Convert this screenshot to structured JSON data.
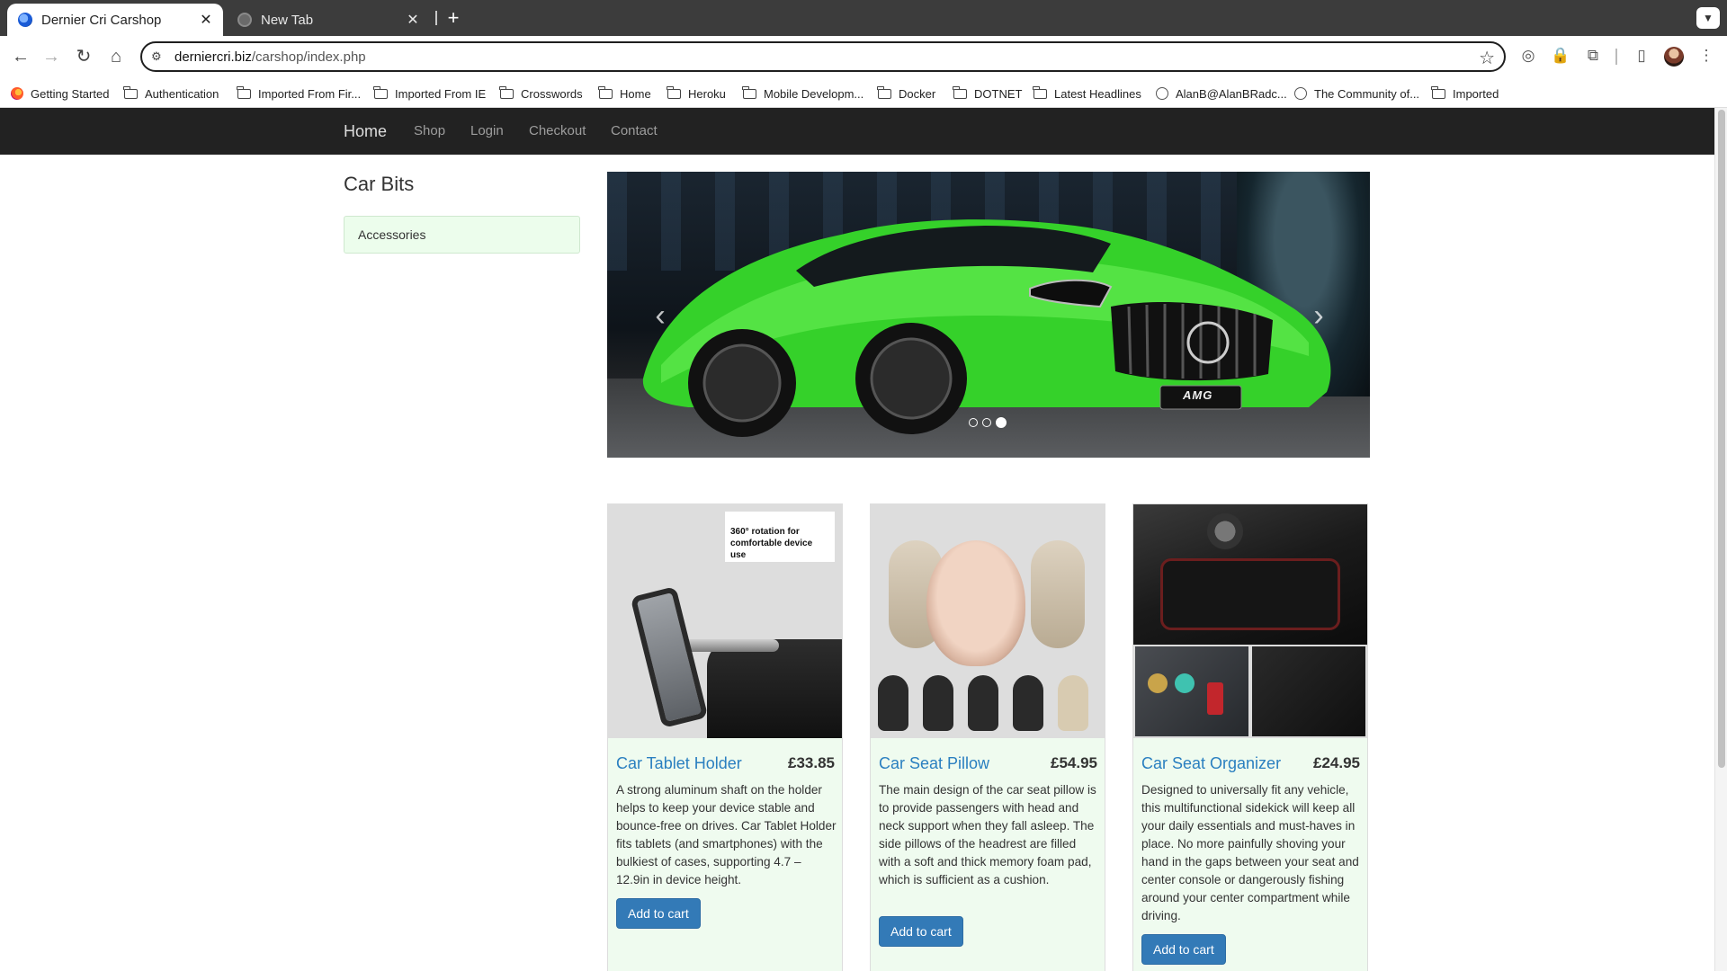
{
  "browser": {
    "tabs": [
      {
        "title": "Dernier Cri Carshop",
        "active": true
      },
      {
        "title": "New Tab",
        "active": false
      }
    ],
    "url_domain": "derniercri.biz",
    "url_path": "/carshop/index.php",
    "bookmarks": [
      {
        "label": "Getting Started",
        "icon": "firefox-icon"
      },
      {
        "label": "Authentication",
        "icon": "folder-icon"
      },
      {
        "label": "Imported From Fir...",
        "icon": "folder-icon"
      },
      {
        "label": "Imported From IE",
        "icon": "folder-icon"
      },
      {
        "label": "Crosswords",
        "icon": "folder-icon"
      },
      {
        "label": "Home",
        "icon": "folder-icon"
      },
      {
        "label": "Heroku",
        "icon": "folder-icon"
      },
      {
        "label": "Mobile Developm...",
        "icon": "folder-icon"
      },
      {
        "label": "Docker",
        "icon": "folder-icon"
      },
      {
        "label": "DOTNET",
        "icon": "folder-icon"
      },
      {
        "label": "Latest Headlines",
        "icon": "folder-icon"
      },
      {
        "label": "AlanB@AlanBRadc...",
        "icon": "globe-icon"
      },
      {
        "label": "The Community of...",
        "icon": "globe-icon"
      },
      {
        "label": "Imported",
        "icon": "folder-icon"
      }
    ]
  },
  "site": {
    "nav": {
      "brand": "Home",
      "items": [
        "Shop",
        "Login",
        "Checkout",
        "Contact"
      ]
    },
    "sidebar": {
      "title": "Car Bits",
      "categories": [
        "Accessories"
      ]
    },
    "carousel": {
      "slides": 3,
      "active_slide": 3,
      "badge": "AMG"
    },
    "tablet_image_caption": "360° rotation for comfortable device use",
    "products": [
      {
        "name": "Car Tablet Holder",
        "price": "£33.85",
        "description": "A strong aluminum shaft on the holder helps to keep your device stable and bounce-free on drives. Car Tablet Holder fits tablets (and smartphones) with the bulkiest of cases, supporting 4.7 – 12.9in in device height.",
        "button": "Add to cart"
      },
      {
        "name": "Car Seat Pillow",
        "price": "£54.95",
        "description": "The main design of the car seat pillow is to provide passengers with head and neck support when they fall asleep. The side pillows of the headrest are filled with a soft and thick memory foam pad, which is sufficient as a cushion.",
        "button": "Add to cart"
      },
      {
        "name": "Car Seat Organizer",
        "price": "£24.95",
        "description": "Designed to universally fit any vehicle, this multifunctional sidekick will keep all your daily essentials and must-haves in place. No more painfully shoving your hand in the gaps between your seat and center console or dangerously fishing around your center compartment while driving.",
        "button": "Add to cart"
      }
    ]
  },
  "colors": {
    "navbar_bg": "#222222",
    "link_blue": "#2a7fc0",
    "button_blue": "#337ab7",
    "card_bg": "#effbef",
    "car_green": "#35d12a"
  }
}
